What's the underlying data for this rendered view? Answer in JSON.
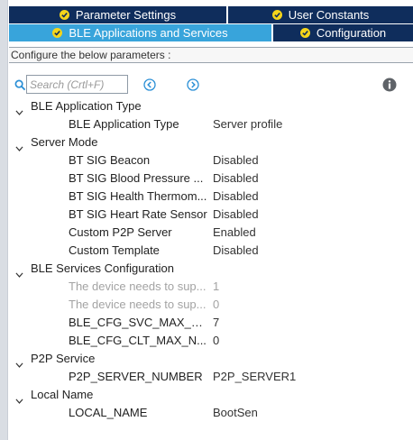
{
  "tabs": {
    "parameter_settings": "Parameter Settings",
    "user_constants": "User Constants",
    "ble_apps": "BLE Applications and Services",
    "configuration": "Configuration"
  },
  "configure_text": "Configure the below parameters :",
  "search": {
    "placeholder": "Search (Crtl+F)"
  },
  "icons": {
    "check": "check-circle-icon",
    "search": "search-icon",
    "prev": "chevron-left-circle-icon",
    "next": "chevron-right-circle-icon",
    "info": "info-icon",
    "expand": "chevron-down-icon"
  },
  "colors": {
    "tab_dark": "#0f2d5c",
    "tab_active": "#38a4db",
    "check": "#f5d51a",
    "nav_icon": "#2a8fd6"
  },
  "groups": [
    {
      "label": "BLE Application Type",
      "params": [
        {
          "name": "BLE Application Type",
          "value": "Server profile",
          "disabled": false
        }
      ]
    },
    {
      "label": "Server Mode",
      "params": [
        {
          "name": "BT SIG Beacon",
          "value": "Disabled",
          "disabled": false
        },
        {
          "name": "BT SIG Blood Pressure ...",
          "value": "Disabled",
          "disabled": false
        },
        {
          "name": "BT SIG Health Thermom...",
          "value": "Disabled",
          "disabled": false
        },
        {
          "name": "BT SIG Heart Rate Sensor",
          "value": "Disabled",
          "disabled": false
        },
        {
          "name": "Custom P2P Server",
          "value": "Enabled",
          "disabled": false
        },
        {
          "name": "Custom Template",
          "value": "Disabled",
          "disabled": false
        }
      ]
    },
    {
      "label": "BLE Services Configuration",
      "params": [
        {
          "name": "The device needs to sup...",
          "value": "1",
          "disabled": true
        },
        {
          "name": "The device needs to sup...",
          "value": "0",
          "disabled": true
        },
        {
          "name": "BLE_CFG_SVC_MAX_N...",
          "value": "7",
          "disabled": false
        },
        {
          "name": "BLE_CFG_CLT_MAX_N...",
          "value": "0",
          "disabled": false
        }
      ]
    },
    {
      "label": "P2P Service",
      "params": [
        {
          "name": "P2P_SERVER_NUMBER",
          "value": "P2P_SERVER1",
          "disabled": false
        }
      ]
    },
    {
      "label": "Local Name",
      "params": [
        {
          "name": "LOCAL_NAME",
          "value": "BootSen",
          "disabled": false
        }
      ]
    }
  ]
}
